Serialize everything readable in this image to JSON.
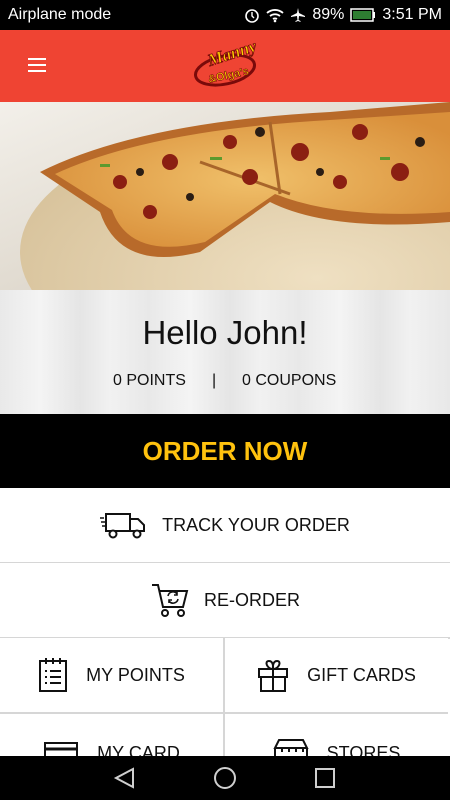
{
  "status": {
    "mode": "Airplane mode",
    "battery": "89%",
    "time": "3:51 PM"
  },
  "brand": {
    "logo_line1": "Manny",
    "logo_line2": "&Olga's"
  },
  "greeting": {
    "hello": "Hello John!",
    "points": "0 POINTS",
    "separator": "|",
    "coupons": "0 COUPONS"
  },
  "order_now": "ORDER NOW",
  "menu": {
    "track": "TRACK YOUR ORDER",
    "reorder": "RE-ORDER",
    "points": "MY POINTS",
    "gift": "GIFT CARDS",
    "card": "MY CARD",
    "stores": "STORES"
  },
  "colors": {
    "appbar": "#ef4433",
    "order_text": "#ffc20e",
    "order_bg": "#000000"
  }
}
